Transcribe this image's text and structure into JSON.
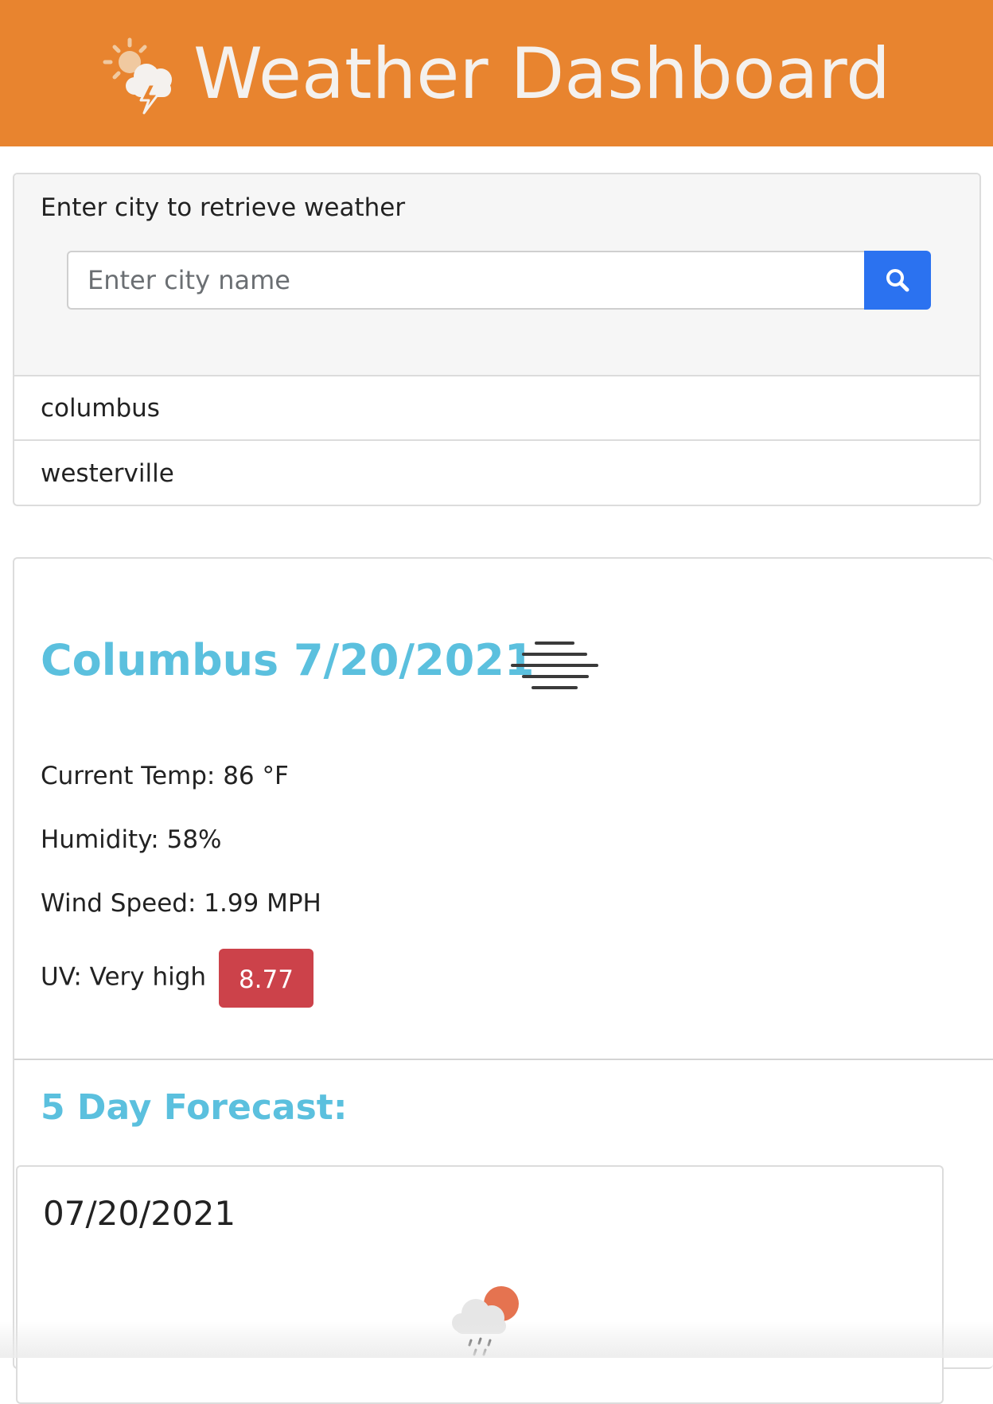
{
  "header": {
    "title": "Weather Dashboard",
    "logo_icon": "weather-storm-icon",
    "background": "#e8842f"
  },
  "search": {
    "label": "Enter city to retrieve weather",
    "placeholder": "Enter city name",
    "value": "",
    "button_icon": "search-icon",
    "button_color": "#2b72f0"
  },
  "history": [
    "columbus",
    "westerville"
  ],
  "current": {
    "city_title": "Columbus 7/20/2021",
    "condition_icon": "mist-icon",
    "temp": "Current Temp: 86 °F",
    "humidity": "Humidity: 58%",
    "wind": "Wind Speed: 1.99 MPH",
    "uv_label": "UV: Very high",
    "uv_value": "8.77",
    "uv_color": "#cc424a"
  },
  "forecast": {
    "title": "5 Day Forecast:",
    "days": [
      {
        "date": "07/20/2021",
        "icon": "rain-sun-icon"
      }
    ]
  }
}
